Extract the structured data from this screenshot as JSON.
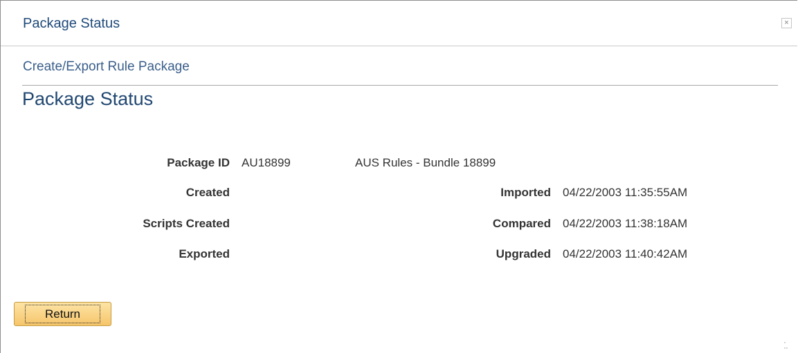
{
  "window": {
    "title": "Package Status",
    "close_label": "×"
  },
  "breadcrumb": "Create/Export Rule Package",
  "page_title": "Package Status",
  "fields": {
    "package_id_label": "Package ID",
    "package_id_value": "AU18899",
    "package_description": "AUS Rules - Bundle 18899",
    "created_label": "Created",
    "created_value": "",
    "scripts_created_label": "Scripts Created",
    "scripts_created_value": "",
    "exported_label": "Exported",
    "exported_value": "",
    "imported_label": "Imported",
    "imported_value": "04/22/2003 11:35:55AM",
    "compared_label": "Compared",
    "compared_value": "04/22/2003 11:38:18AM",
    "upgraded_label": "Upgraded",
    "upgraded_value": "04/22/2003 11:40:42AM"
  },
  "actions": {
    "return_label": "Return"
  },
  "colors": {
    "title_blue": "#1f4a7a",
    "button_gold": "#f6c56b"
  }
}
